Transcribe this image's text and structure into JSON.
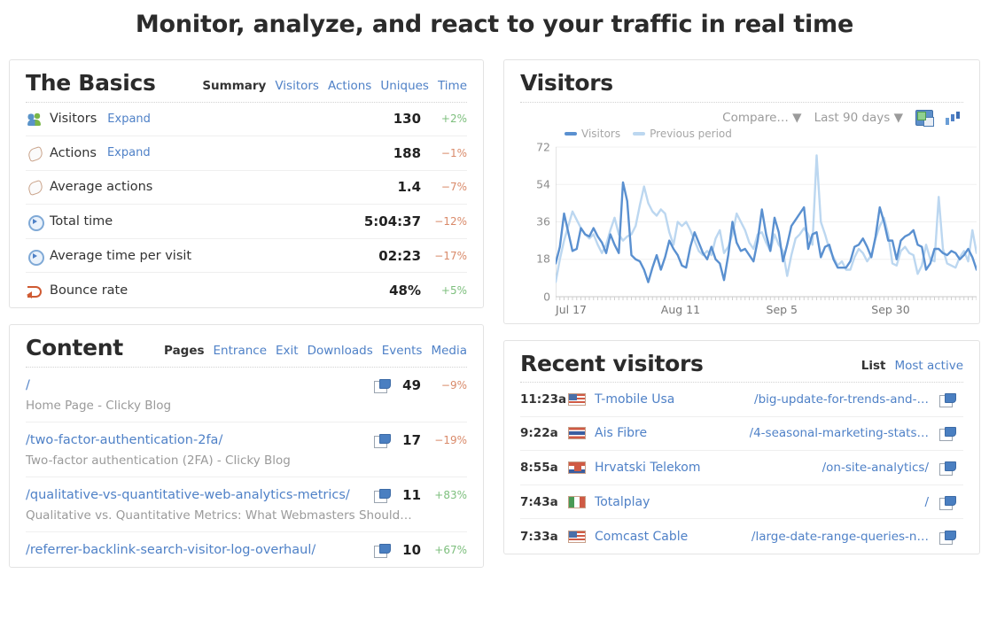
{
  "headline": "Monitor, analyze, and react to your traffic in real time",
  "colors": {
    "link": "#4f81c7",
    "up": "#7dbf7d",
    "down": "#d98a6a",
    "series_visitors": "#5a90d0",
    "series_previous": "#bcd7f0"
  },
  "basics": {
    "title": "The Basics",
    "tabs": [
      {
        "label": "Summary",
        "active": true
      },
      {
        "label": "Visitors",
        "active": false
      },
      {
        "label": "Actions",
        "active": false
      },
      {
        "label": "Uniques",
        "active": false
      },
      {
        "label": "Time",
        "active": false
      }
    ],
    "rows": [
      {
        "icon": "visitors-icon",
        "label": "Visitors",
        "expand": "Expand",
        "value": "130",
        "delta": "+2%",
        "dir": "up"
      },
      {
        "icon": "mouse-icon",
        "label": "Actions",
        "expand": "Expand",
        "value": "188",
        "delta": "−1%",
        "dir": "down"
      },
      {
        "icon": "mouse-icon",
        "label": "Average actions",
        "expand": "",
        "value": "1.4",
        "delta": "−7%",
        "dir": "down"
      },
      {
        "icon": "clock-icon",
        "label": "Total time",
        "expand": "",
        "value": "5:04:37",
        "delta": "−12%",
        "dir": "down"
      },
      {
        "icon": "clock-icon",
        "label": "Average time per visit",
        "expand": "",
        "value": "02:23",
        "delta": "−17%",
        "dir": "down"
      },
      {
        "icon": "bounce-icon",
        "label": "Bounce rate",
        "expand": "",
        "value": "48%",
        "delta": "+5%",
        "dir": "up"
      }
    ]
  },
  "content": {
    "title": "Content",
    "tabs": [
      {
        "label": "Pages",
        "active": true
      },
      {
        "label": "Entrance",
        "active": false
      },
      {
        "label": "Exit",
        "active": false
      },
      {
        "label": "Downloads",
        "active": false
      },
      {
        "label": "Events",
        "active": false
      },
      {
        "label": "Media",
        "active": false
      }
    ],
    "rows": [
      {
        "url": "/",
        "subtitle": "Home Page - Clicky Blog",
        "value": "49",
        "delta": "−9%",
        "dir": "down"
      },
      {
        "url": "/two-factor-authentication-2fa/",
        "subtitle": "Two-factor authentication (2FA) - Clicky Blog",
        "value": "17",
        "delta": "−19%",
        "dir": "down"
      },
      {
        "url": "/qualitative-vs-quantitative-web-analytics-metrics/",
        "subtitle": "Qualitative vs. Quantitative Metrics: What Webmasters Should…",
        "value": "11",
        "delta": "+83%",
        "dir": "up"
      },
      {
        "url": "/referrer-backlink-search-visitor-log-overhaul/",
        "subtitle": "",
        "value": "10",
        "delta": "+67%",
        "dir": "up"
      }
    ]
  },
  "visitors_panel": {
    "title": "Visitors",
    "toolbar": {
      "compare": "Compare… ▼",
      "range": "Last 90 days ▼",
      "save_icon": "save-icon",
      "bars_icon": "bar-chart-icon"
    },
    "legend": [
      {
        "label": "Visitors",
        "color": "#5a90d0"
      },
      {
        "label": "Previous period",
        "color": "#bcd7f0"
      }
    ]
  },
  "chart_data": {
    "type": "line",
    "title": "Visitors",
    "xlabel": "",
    "ylabel": "",
    "ylim": [
      0,
      72
    ],
    "yticks": [
      0,
      18,
      36,
      54,
      72
    ],
    "xticks": [
      "Jul 17",
      "Aug 11",
      "Sep 5",
      "Sep 30"
    ],
    "xtick_positions": [
      0,
      25,
      50,
      75
    ],
    "grid": true,
    "legend_position": "top-left",
    "series": [
      {
        "name": "Visitors",
        "color": "#5a90d0",
        "values": [
          16,
          24,
          40,
          31,
          22,
          23,
          33,
          30,
          29,
          33,
          29,
          26,
          21,
          30,
          25,
          21,
          55,
          46,
          20,
          18,
          17,
          13,
          7,
          14,
          20,
          13,
          19,
          27,
          23,
          20,
          15,
          14,
          24,
          31,
          26,
          21,
          18,
          24,
          18,
          16,
          8,
          20,
          36,
          26,
          22,
          23,
          20,
          17,
          27,
          42,
          30,
          22,
          38,
          31,
          17,
          25,
          34,
          37,
          40,
          43,
          23,
          30,
          31,
          19,
          24,
          25,
          18,
          14,
          14,
          14,
          17,
          24,
          25,
          28,
          24,
          19,
          29,
          43,
          36,
          27,
          27,
          18,
          27,
          29,
          30,
          32,
          25,
          24,
          13,
          16,
          23,
          23,
          21,
          20,
          22,
          21,
          18,
          20,
          23,
          19,
          13
        ]
      },
      {
        "name": "Previous period",
        "color": "#bcd7f0",
        "values": [
          7,
          18,
          27,
          34,
          41,
          37,
          33,
          30,
          28,
          30,
          25,
          21,
          25,
          32,
          38,
          30,
          27,
          29,
          30,
          34,
          44,
          53,
          45,
          41,
          39,
          42,
          40,
          31,
          25,
          36,
          34,
          36,
          32,
          27,
          22,
          20,
          22,
          20,
          28,
          32,
          21,
          24,
          30,
          40,
          36,
          32,
          26,
          23,
          30,
          31,
          26,
          22,
          30,
          25,
          22,
          10,
          20,
          28,
          30,
          33,
          30,
          25,
          68,
          36,
          30,
          23,
          19,
          15,
          17,
          13,
          13,
          19,
          23,
          21,
          17,
          20,
          28,
          34,
          38,
          30,
          16,
          15,
          22,
          24,
          21,
          20,
          11,
          15,
          25,
          18,
          17,
          48,
          23,
          16,
          15,
          14,
          19,
          22,
          17,
          32,
          21
        ]
      }
    ]
  },
  "recent": {
    "title": "Recent visitors",
    "tabs": [
      {
        "label": "List",
        "active": true
      },
      {
        "label": "Most active",
        "active": false
      }
    ],
    "rows": [
      {
        "time": "11:23a",
        "flag": "flag-us",
        "flag_name": "flag-united-states",
        "isp": "T-mobile Usa",
        "path": "/big-update-for-trends-and-…"
      },
      {
        "time": "9:22a",
        "flag": "flag-th",
        "flag_name": "flag-thailand",
        "isp": "Ais Fibre",
        "path": "/4-seasonal-marketing-stats…"
      },
      {
        "time": "8:55a",
        "flag": "flag-hr",
        "flag_name": "flag-croatia",
        "isp": "Hrvatski Telekom",
        "path": "/on-site-analytics/"
      },
      {
        "time": "7:43a",
        "flag": "flag-mx",
        "flag_name": "flag-mexico",
        "isp": "Totalplay",
        "path": "/"
      },
      {
        "time": "7:33a",
        "flag": "flag-us",
        "flag_name": "flag-united-states",
        "isp": "Comcast Cable",
        "path": "/large-date-range-queries-n…"
      }
    ]
  }
}
